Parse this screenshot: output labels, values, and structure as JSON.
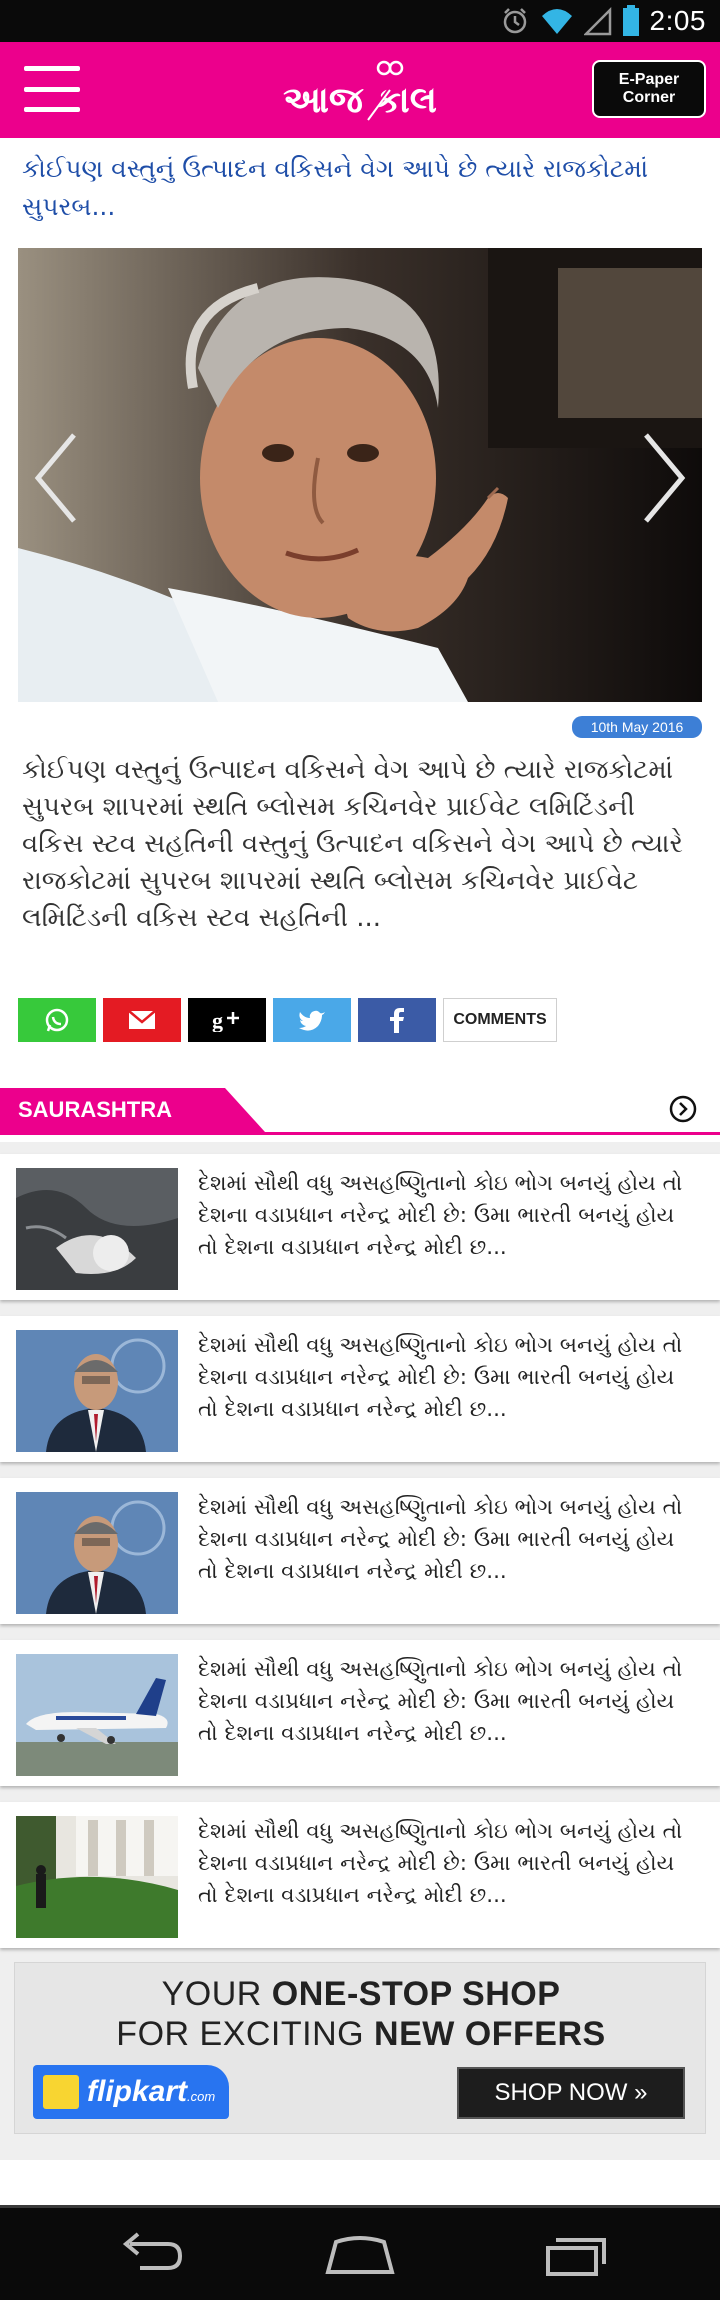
{
  "status_bar": {
    "time": "2:05"
  },
  "header": {
    "logo_text": "આજ કાલ",
    "epaper_label_line1": "E-Paper",
    "epaper_label_line2": "Corner"
  },
  "top_story": {
    "headline": "કોઈપણ વસ્તુનું ઉત્પાદન વકિસને વેગ આપે છે ત્યારે રાજકોટમાં સુપરબ...",
    "date": "10th May 2016",
    "body": "કોઈપણ વસ્તુનું ઉત્પાદન વકિસને વેગ આપે છે ત્યારે રાજકોટમાં સુપરબ શાપરમાં સ્થતિ બ્લોસમ કચિનવેર પ્રાઈવેટ લમિટિંડની વકિસ સ્ટવ સહતિની વસ્તુનું ઉત્પાદન વકિસને વેગ આપે છે ત્યારે રાજકોટમાં સુપરબ શાપરમાં સ્થતિ બ્લોસમ કચિનવેર પ્રાઈવેટ લમિટિંડની વકિસ સ્ટવ સહતિની ..."
  },
  "share": {
    "comments_label": "COMMENTS"
  },
  "section": {
    "title": "SAURASHTRA"
  },
  "news": [
    {
      "text": "દેશમાં સૌથી વધુ અસહષ્ણુિતાનો કોઇ ભોગ બનયું હોય તો દેશના વડાપ્રધાન નરેન્દ્ર મોદી છે: ઉમા ભારતી બનયું હોય તો દેશના વડાપ્રધાન નરેન્દ્ર મોદી છ..."
    },
    {
      "text": "દેશમાં સૌથી વધુ અસહષ્ણુિતાનો કોઇ ભોગ બનયું હોય તો દેશના વડાપ્રધાન નરેન્દ્ર મોદી છે: ઉમા ભારતી બનયું હોય તો દેશના વડાપ્રધાન નરેન્દ્ર મોદી છ..."
    },
    {
      "text": "દેશમાં સૌથી વધુ અસહષ્ણુિતાનો કોઇ ભોગ બનયું હોય તો દેશના વડાપ્રધાન નરેન્દ્ર મોદી છે: ઉમા ભારતી બનયું હોય તો દેશના વડાપ્રધાન નરેન્દ્ર મોદી છ..."
    },
    {
      "text": "દેશમાં સૌથી વધુ અસહષ્ણુિતાનો કોઇ ભોગ બનયું હોય તો દેશના વડાપ્રધાન નરેન્દ્ર મોદી છે: ઉમા ભારતી બનયું હોય તો દેશના વડાપ્રધાન નરેન્દ્ર મોદી છ..."
    },
    {
      "text": "દેશમાં સૌથી વધુ અસહષ્ણુિતાનો કોઇ ભોગ બનયું હોય તો દેશના વડાપ્રધાન નરેન્દ્ર મોદી છે: ઉમા ભારતી બનયું હોય તો દેશના વડાપ્રધાન નરેન્દ્ર મોદી છ..."
    }
  ],
  "ad": {
    "line1_a": "YOUR ",
    "line1_b": "ONE-STOP SHOP",
    "line2_a": "FOR EXCITING ",
    "line2_b": "NEW OFFERS",
    "brand": "flipkart",
    "brand_suffix": ".com",
    "cta": "SHOP NOW »"
  },
  "colors": {
    "brand": "#ec008c",
    "link": "#1f4ea8",
    "badge": "#3d7fd6"
  }
}
